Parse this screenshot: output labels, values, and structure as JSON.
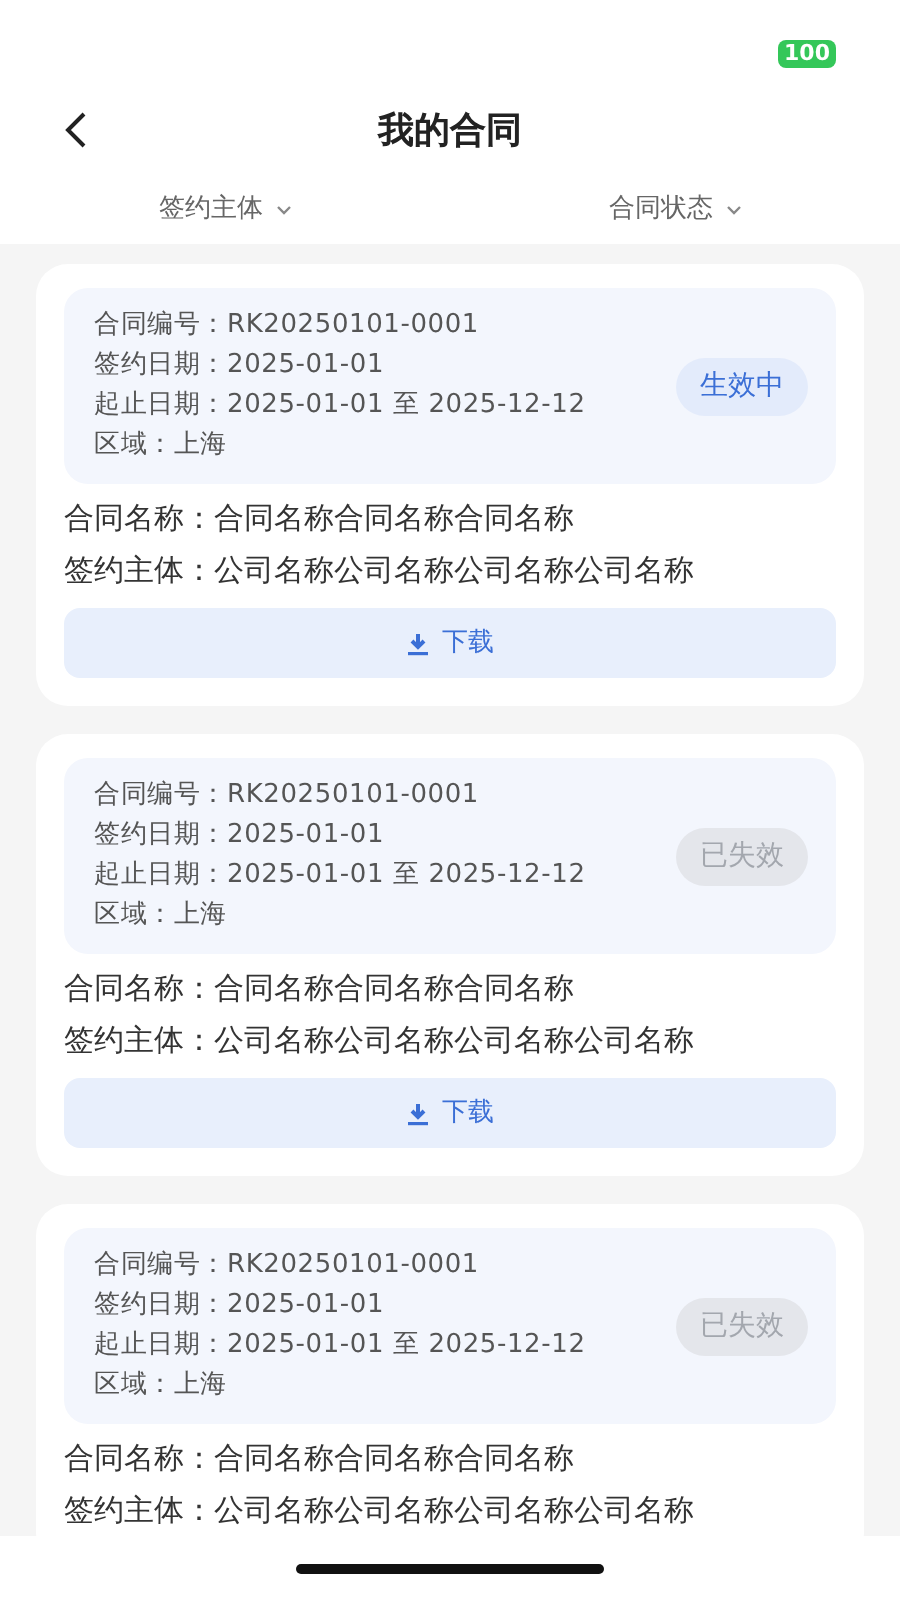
{
  "status_bar": {
    "battery": "100"
  },
  "header": {
    "title": "我的合同"
  },
  "filters": [
    {
      "label": "签约主体"
    },
    {
      "label": "合同状态"
    }
  ],
  "contracts": [
    {
      "info": [
        "合同编号：RK20250101-0001",
        "签约日期：2025-01-01",
        "起止日期：2025-01-01 至 2025-12-12",
        "区域：上海"
      ],
      "status": {
        "label": "生效中",
        "kind": "active"
      },
      "name": "合同名称：合同名称合同名称合同名称",
      "party": "签约主体：公司名称公司名称公司名称公司名称",
      "download": "下载"
    },
    {
      "info": [
        "合同编号：RK20250101-0001",
        "签约日期：2025-01-01",
        "起止日期：2025-01-01 至 2025-12-12",
        "区域：上海"
      ],
      "status": {
        "label": "已失效",
        "kind": "expired"
      },
      "name": "合同名称：合同名称合同名称合同名称",
      "party": "签约主体：公司名称公司名称公司名称公司名称",
      "download": "下载"
    },
    {
      "info": [
        "合同编号：RK20250101-0001",
        "签约日期：2025-01-01",
        "起止日期：2025-01-01 至 2025-12-12",
        "区域：上海"
      ],
      "status": {
        "label": "已失效",
        "kind": "expired"
      },
      "name": "合同名称：合同名称合同名称合同名称",
      "party": "签约主体：公司名称公司名称公司名称公司名称"
    }
  ]
}
